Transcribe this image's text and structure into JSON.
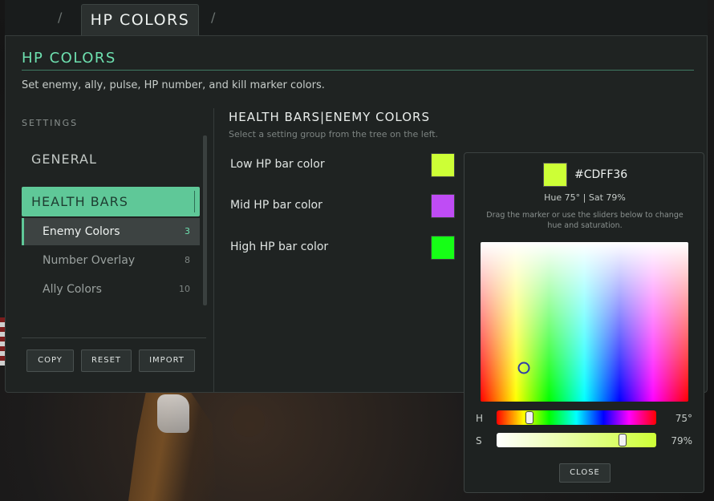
{
  "tabbar": {
    "active_tab": "HP COLORS",
    "separators": [
      "/",
      "/"
    ]
  },
  "panel": {
    "title": "HP COLORS",
    "description": "Set enemy, ally, pulse, HP number, and kill marker colors."
  },
  "sidebar": {
    "heading": "SETTINGS",
    "sections": [
      {
        "label": "GENERAL",
        "selected": false
      },
      {
        "label": "HEALTH BARS",
        "selected": true
      }
    ],
    "items": [
      {
        "label": "Enemy Colors",
        "count": "3",
        "selected": true
      },
      {
        "label": "Number Overlay",
        "count": "8",
        "selected": false
      },
      {
        "label": "Ally Colors",
        "count": "10",
        "selected": false
      }
    ],
    "buttons": {
      "copy": "COPY",
      "reset": "RESET",
      "import": "IMPORT"
    }
  },
  "content": {
    "title": "HEALTH BARS|ENEMY COLORS",
    "subtitle": "Select a setting group from the tree on the left.",
    "settings": [
      {
        "label": "Low HP bar color",
        "color": "#cdff36"
      },
      {
        "label": "Mid HP bar color",
        "color": "#bf4cf5"
      },
      {
        "label": "High HP bar color",
        "color": "#16ff16"
      }
    ]
  },
  "picker": {
    "color": "#cdff36",
    "hex": "#CDFF36",
    "hue_sat_text": "Hue 75° | Sat 79%",
    "help_text": "Drag the marker or use the sliders below to change hue and saturation.",
    "hue_label": "H",
    "sat_label": "S",
    "hue_value": "75°",
    "sat_value": "79%",
    "hue_degrees": 75,
    "sat_percent": 79,
    "close_label": "CLOSE"
  }
}
